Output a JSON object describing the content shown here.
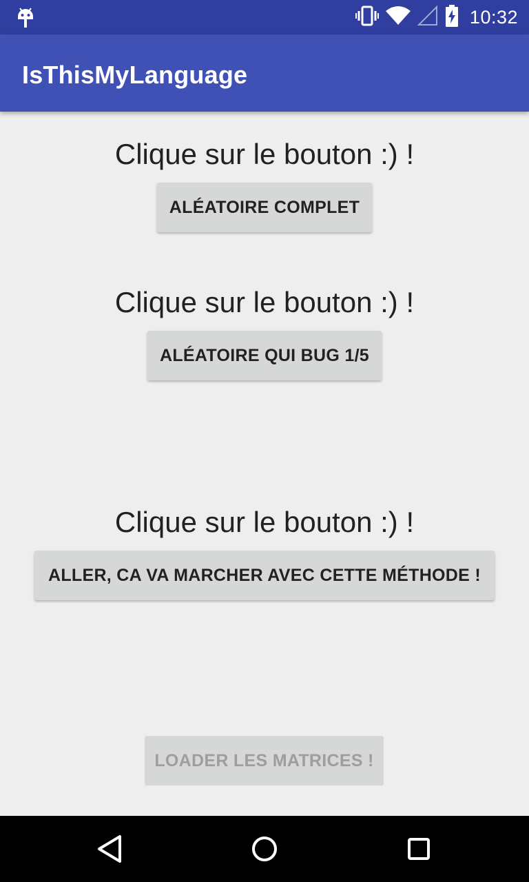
{
  "status_bar": {
    "time": "10:32",
    "icons": [
      "android-debug-icon",
      "vibrate-icon",
      "wifi-icon",
      "signal-icon",
      "battery-charging-icon"
    ]
  },
  "app_bar": {
    "title": "IsThisMyLanguage"
  },
  "main": {
    "sections": [
      {
        "prompt": "Clique sur le bouton :) !",
        "button_label": "Aléatoire complet"
      },
      {
        "prompt": "Clique sur le bouton :) !",
        "button_label": "Aléatoire qui bug 1/5"
      },
      {
        "prompt": "Clique sur le bouton :) !",
        "button_label": "Aller, ca va marcher avec cette méthode !"
      }
    ],
    "load_button_label": "Loader les matrices !"
  },
  "nav_bar": {
    "icons": [
      "back-icon",
      "home-icon",
      "recents-icon"
    ]
  },
  "colors": {
    "status_bar": "#303f9f",
    "app_bar": "#3f51b5",
    "background": "#eeeeee",
    "button": "#d6d7d7"
  }
}
